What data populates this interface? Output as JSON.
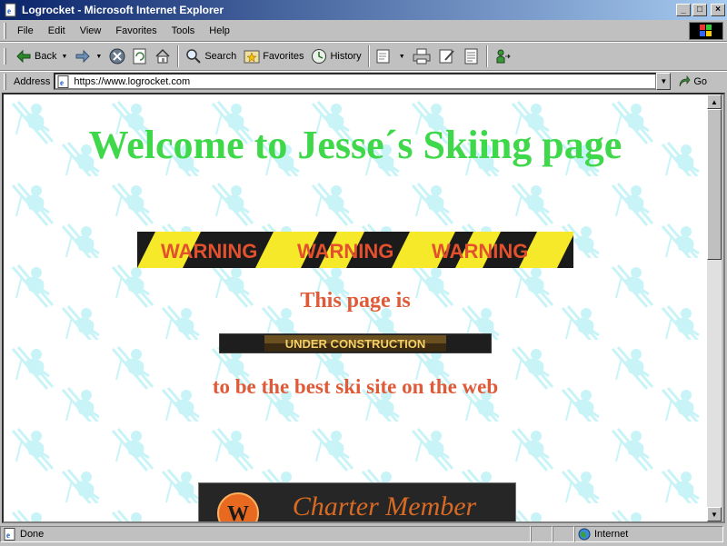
{
  "window": {
    "title": "Logrocket - Microsoft Internet Explorer",
    "min_glyph": "_",
    "max_glyph": "□",
    "close_glyph": "×"
  },
  "menu": {
    "items": [
      {
        "label": "File"
      },
      {
        "label": "Edit"
      },
      {
        "label": "View"
      },
      {
        "label": "Favorites"
      },
      {
        "label": "Tools"
      },
      {
        "label": "Help"
      }
    ]
  },
  "toolbar": {
    "back_label": "Back",
    "search_label": "Search",
    "favorites_label": "Favorites",
    "history_label": "History"
  },
  "address": {
    "label": "Address",
    "url": "https://www.logrocket.com",
    "go_label": "Go"
  },
  "page": {
    "heading": "Welcome to Jesse´s Skiing page",
    "warning_text": "WARNING",
    "this_page_is": "This page is",
    "under_construction": "UNDER CONSTRUCTION",
    "best_site": "to be the best ski site on the web",
    "charter_text": "Charter Member"
  },
  "status": {
    "text": "Done",
    "zone": "Internet"
  },
  "colors": {
    "heading": "#3ed84a",
    "body_text": "#e05a38",
    "skier_pattern": "#c8f4f8",
    "warning_yellow": "#f5e92a",
    "warning_red": "#e2502e"
  },
  "icons": [
    "ie-page-icon",
    "back-arrow-icon",
    "forward-arrow-icon",
    "stop-icon",
    "refresh-icon",
    "home-icon",
    "search-icon",
    "favorites-icon",
    "history-icon",
    "mail-icon",
    "print-icon",
    "edit-icon",
    "discuss-icon",
    "messenger-icon",
    "go-arrow-icon",
    "globe-icon",
    "windows-logo-icon"
  ]
}
